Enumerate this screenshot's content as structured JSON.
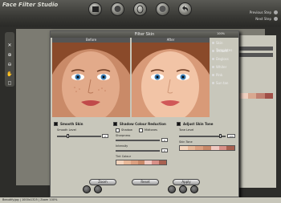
{
  "app": {
    "title": "Face Filter Studio"
  },
  "nav": {
    "previous": "Previous Step",
    "next": "Next Step"
  },
  "dialog": {
    "title": "Filter Skin",
    "zoom": "100%",
    "before": "Before",
    "after": "After"
  },
  "options": [
    "Skin Templates",
    "Smooth",
    "Degloss",
    "Whiter",
    "Pink",
    "Sun tan"
  ],
  "smooth": {
    "title": "Smooth Skin",
    "level_label": "Smooth Level",
    "level_value": "2"
  },
  "shadow": {
    "title": "Shadow Colour Reduction",
    "shadow_label": "Shadow",
    "midtones_label": "Midtones",
    "sharpness_label": "Sharpness",
    "sharpness_value": "0",
    "intensity_label": "Intensity",
    "intensity_value": "0",
    "tint_label": "Tint Colour"
  },
  "tone": {
    "title": "Adjust Skin Tone",
    "level_label": "Tone Level",
    "level_value": "100",
    "tone_label": "Skin Tone"
  },
  "buttons": {
    "zoom": "Zoom",
    "reset": "Reset",
    "apply": "Apply"
  },
  "status": "Beautify.jpg  |  1000x1325  |  Zoom 100%",
  "colors": {
    "swatches": [
      "#f4d4bc",
      "#e8b898",
      "#dca080",
      "#c88868",
      "#f0c8c0",
      "#d89088",
      "#a86050"
    ]
  }
}
